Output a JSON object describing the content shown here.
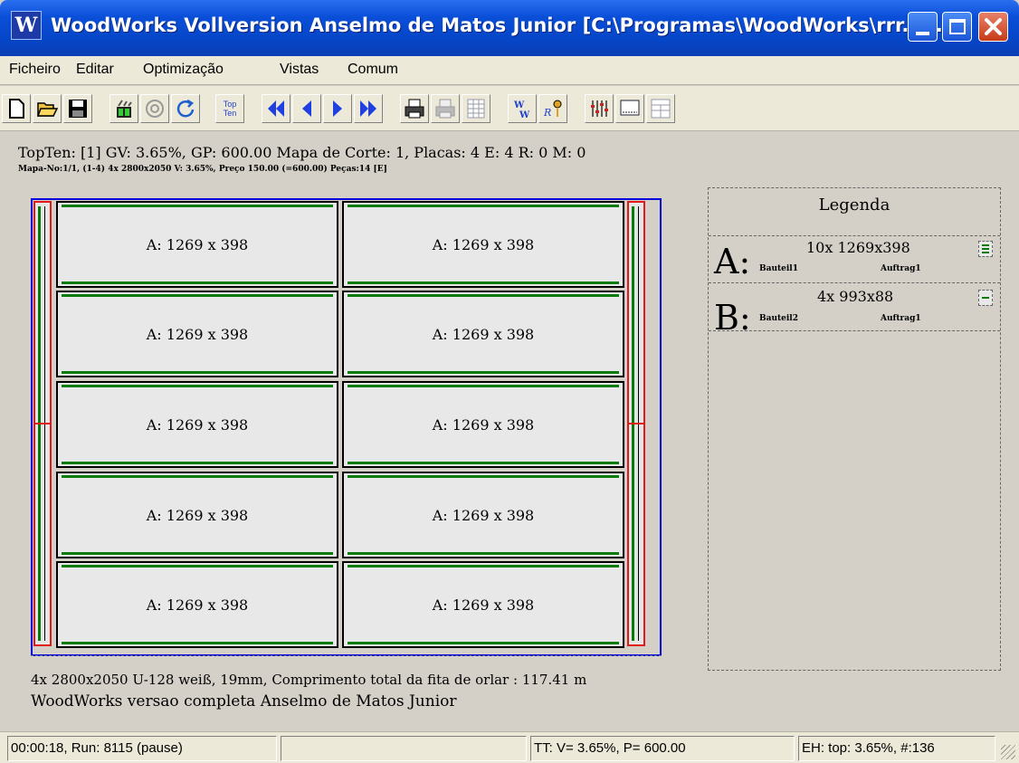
{
  "window": {
    "title": "WoodWorks Vollversion Anselmo de Matos Junior [C:\\Programas\\WoodWorks\\rrr.x...",
    "app_icon": "W"
  },
  "menu": [
    "Ficheiro",
    "Editar",
    "Optimização",
    "Vistas",
    "Comum"
  ],
  "toolbar": {
    "buttons": [
      "new-icon",
      "open-icon",
      "save-icon",
      "optimize-icon",
      "stop-icon",
      "refresh-icon",
      "topten-icon",
      "first-icon",
      "prev-icon",
      "next-icon",
      "last-icon",
      "print-icon",
      "print-preview-icon",
      "grid-icon",
      "ww-icon",
      "key-icon",
      "settings-icon",
      "view-icon",
      "layout-icon"
    ],
    "topten_label_top": "Top",
    "topten_label_bottom": "Ten"
  },
  "info": {
    "line1": "TopTen: [1] GV:  3.65%, GP: 600.00 Mapa de Corte: 1, Placas: 4 E: 4 R: 0 M: 0",
    "line2": "Mapa-No:1/1, (1-4) 4x 2800x2050 V: 3.65%, Preço 150.00 (=600.00) Peças:14 [E]"
  },
  "parts": [
    "A: 1269 x 398",
    "A: 1269 x 398",
    "A: 1269 x 398",
    "A: 1269 x 398",
    "A: 1269 x 398",
    "A: 1269 x 398",
    "A: 1269 x 398",
    "A: 1269 x 398",
    "A: 1269 x 398",
    "A: 1269 x 398"
  ],
  "footer": {
    "line1": "4x 2800x2050 U-128 weiß, 19mm, Comprimento total da fita de orlar : 117.41 m",
    "line2": "WoodWorks versao completa Anselmo de Matos Junior"
  },
  "legend": {
    "title": "Legenda",
    "items": [
      {
        "letter": "A:",
        "qty": "10x 1269x398",
        "part": "Bauteil1",
        "order": "Auftrag1"
      },
      {
        "letter": "B:",
        "qty": "4x 993x88",
        "part": "Bauteil2",
        "order": "Auftrag1"
      }
    ]
  },
  "status": {
    "run": "00:00:18, Run: 8115 (pause)",
    "empty": "",
    "tt": "TT: V= 3.65%, P= 600.00",
    "eh": "EH: top: 3.65%,  #:136"
  },
  "colors": {
    "titlebar": "#0a4fd8",
    "board_border": "#0000dd",
    "edge_banding": "#0a7a0a",
    "strip_border": "#e01a1a"
  }
}
